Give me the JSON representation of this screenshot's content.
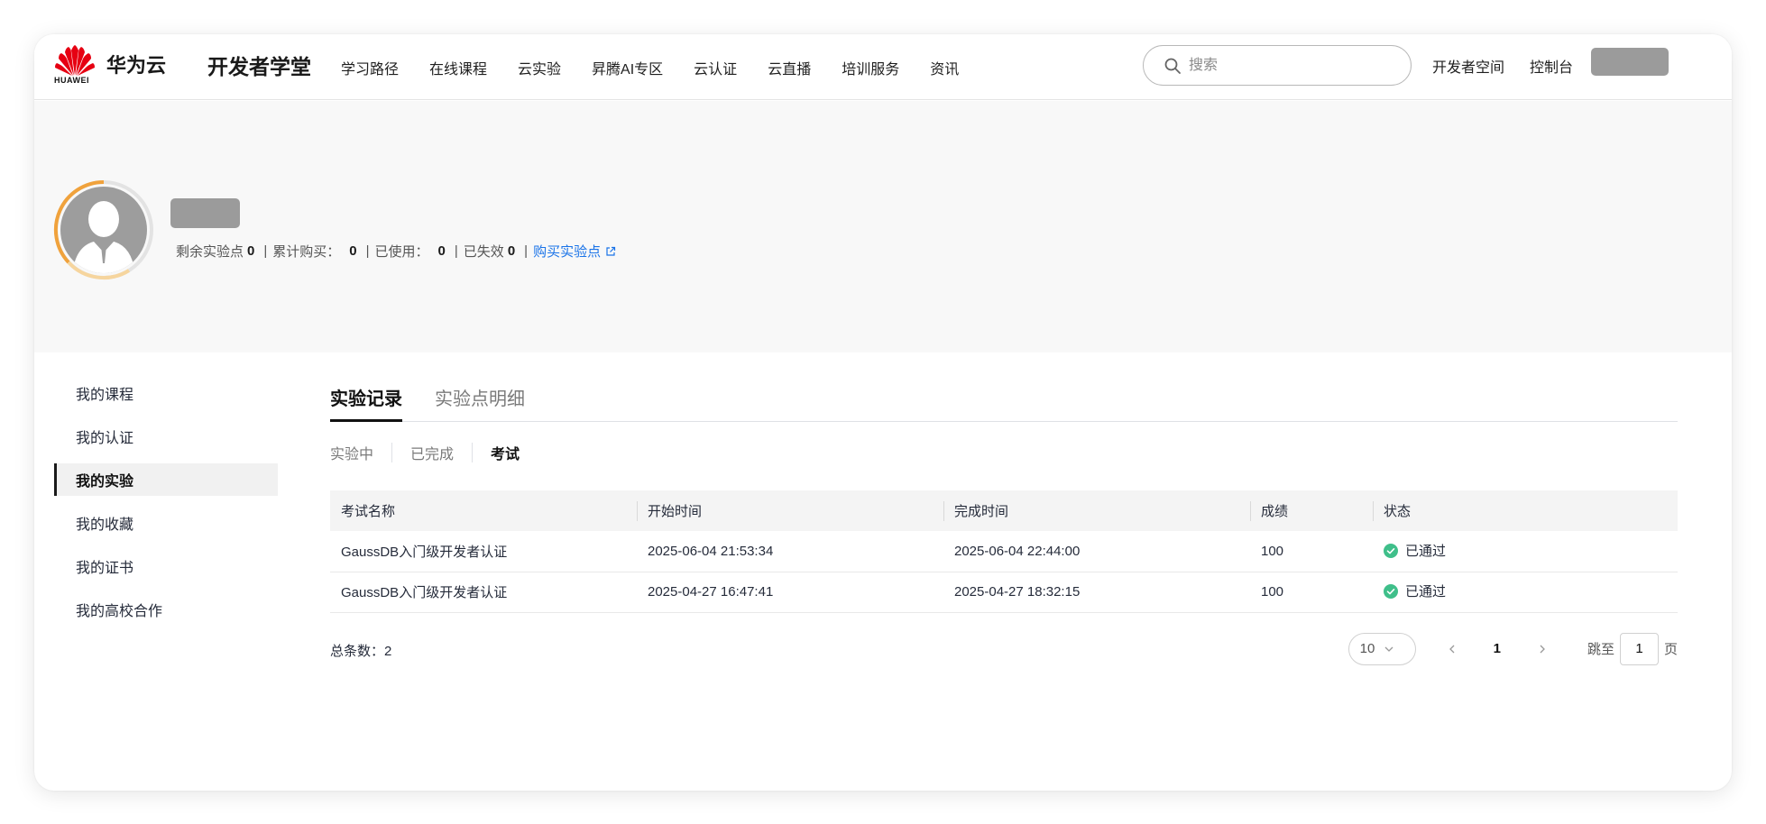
{
  "header": {
    "brand": "华为云",
    "logo_text": "HUAWEI",
    "site_title": "开发者学堂",
    "nav": [
      "学习路径",
      "在线课程",
      "云实验",
      "昇腾AI专区",
      "云认证",
      "云直播",
      "培训服务",
      "资讯"
    ],
    "search_placeholder": "搜索",
    "dev_space": "开发者空间",
    "console": "控制台",
    "brand_color": "#e60012"
  },
  "profile": {
    "stats": {
      "remaining_label": "剩余实验点",
      "remaining": "0",
      "purchased_label": "累计购买：",
      "purchased": "0",
      "used_label": "已使用：",
      "used": "0",
      "expired_label": "已失效",
      "expired": "0",
      "separator": "|",
      "buy_link": "购买实验点"
    },
    "link_color": "#1a73e8"
  },
  "sidebar": {
    "items": [
      "我的课程",
      "我的认证",
      "我的实验",
      "我的收藏",
      "我的证书",
      "我的高校合作"
    ],
    "active_index": 2
  },
  "main": {
    "tabs": [
      "实验记录",
      "实验点明细"
    ],
    "subtabs": [
      "实验中",
      "已完成",
      "考试"
    ],
    "table": {
      "headers": [
        "考试名称",
        "开始时间",
        "完成时间",
        "成绩",
        "状态"
      ],
      "rows": [
        [
          "GaussDB入门级开发者认证",
          "2025-06-04 21:53:34",
          "2025-06-04 22:44:00",
          "100",
          "已通过"
        ],
        [
          "GaussDB入门级开发者认证",
          "2025-04-27 16:47:41",
          "2025-04-27 18:32:15",
          "100",
          "已通过"
        ]
      ],
      "status_color": "#3fbf8a"
    },
    "total": "总条数：2",
    "pager": {
      "page_size": "10",
      "current_page": "1",
      "jump_label": "跳至",
      "jump_value": "1",
      "page_unit": "页"
    }
  }
}
